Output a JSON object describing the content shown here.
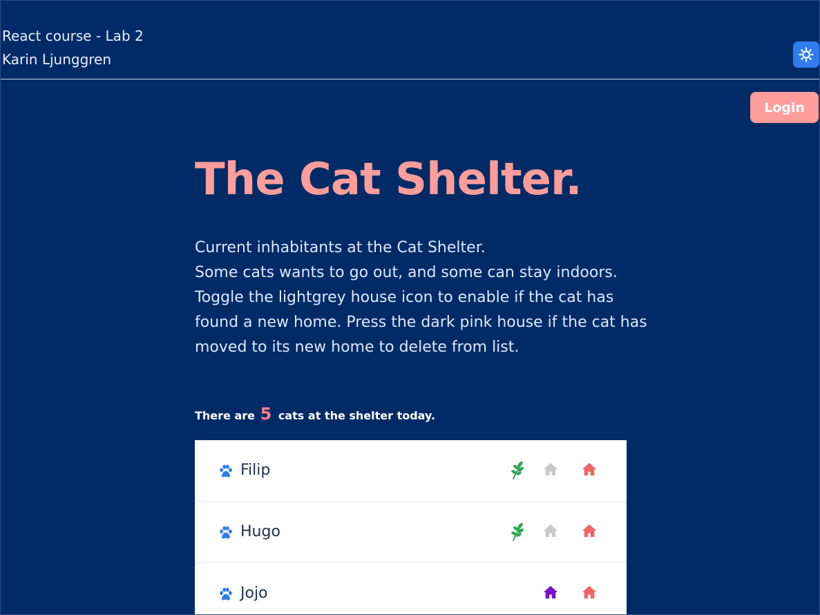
{
  "header": {
    "line1": "React course - Lab 2",
    "line2": "Karin Ljunggren",
    "theme_toggle_icon": "sun-icon"
  },
  "login_label": "Login",
  "main": {
    "title": "The Cat Shelter.",
    "description": [
      "Current inhabitants at the Cat Shelter.",
      "Some cats wants to go out, and some can stay indoors.",
      "Toggle the lightgrey house icon to enable if the cat has",
      "found a new home. Press the dark pink house if the cat has",
      "moved to its new home to delete from list."
    ],
    "count_prefix": "There are",
    "count": "5",
    "count_suffix": "cats at the shelter today."
  },
  "cats": [
    {
      "name": "Filip",
      "outdoor": true,
      "home_found": false
    },
    {
      "name": "Hugo",
      "outdoor": true,
      "home_found": false
    },
    {
      "name": "Jojo",
      "outdoor": false,
      "home_found": true
    }
  ],
  "colors": {
    "background": "#002b66",
    "accent_pink": "#ff9d9a",
    "count_pink": "#ff7f8c",
    "paw_blue": "#2f7cf0",
    "leaf_green": "#2ea94f",
    "house_grey": "#c9c9c9",
    "house_pink": "#f26464",
    "house_purple": "#7a13c9",
    "theme_button": "#2f7cf0"
  },
  "icons": {
    "paw": "paw-icon",
    "leaf": "leaf-icon",
    "house": "house-icon"
  }
}
